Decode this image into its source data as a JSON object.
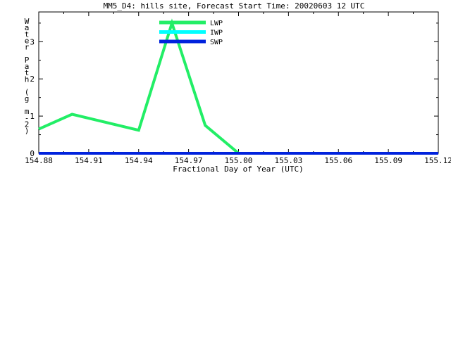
{
  "chart_data": {
    "type": "line",
    "title": "MM5_D4: hills site,  Forecast Start Time: 20020603 12 UTC",
    "xlabel": "Fractional Day of Year (UTC)",
    "ylabel": "Water Path (g m-2)",
    "ylabel_chars": [
      "W",
      "a",
      "t",
      "e",
      "r",
      "",
      "P",
      "a",
      "t",
      "h",
      "",
      "(",
      "g",
      "",
      "m",
      "-",
      "2",
      ")"
    ],
    "xlim": [
      154.88,
      155.12
    ],
    "ylim": [
      0,
      3.8
    ],
    "xticks": [
      154.88,
      154.91,
      154.94,
      154.97,
      155.0,
      155.03,
      155.06,
      155.09,
      155.12
    ],
    "xtick_labels": [
      "154.88",
      "154.91",
      "154.94",
      "154.97",
      "155.00",
      "155.03",
      "155.06",
      "155.09",
      "155.12"
    ],
    "yticks": [
      0,
      1,
      2,
      3
    ],
    "ytick_labels": [
      "0",
      "1",
      "2",
      "3"
    ],
    "grid": false,
    "legend_position": "top-center",
    "series": [
      {
        "name": "LWP",
        "color": "#22ee66",
        "x": [
          154.88,
          154.9,
          154.94,
          154.96,
          154.98,
          155.0,
          155.12
        ],
        "y": [
          0.65,
          1.05,
          0.62,
          3.5,
          0.75,
          0.0,
          0.0
        ]
      },
      {
        "name": "IWP",
        "color": "#00ffff",
        "x": [
          154.88,
          155.12
        ],
        "y": [
          0.0,
          0.0
        ]
      },
      {
        "name": "SWP",
        "color": "#0022dd",
        "x": [
          154.88,
          155.12
        ],
        "y": [
          0.0,
          0.0
        ]
      }
    ]
  }
}
